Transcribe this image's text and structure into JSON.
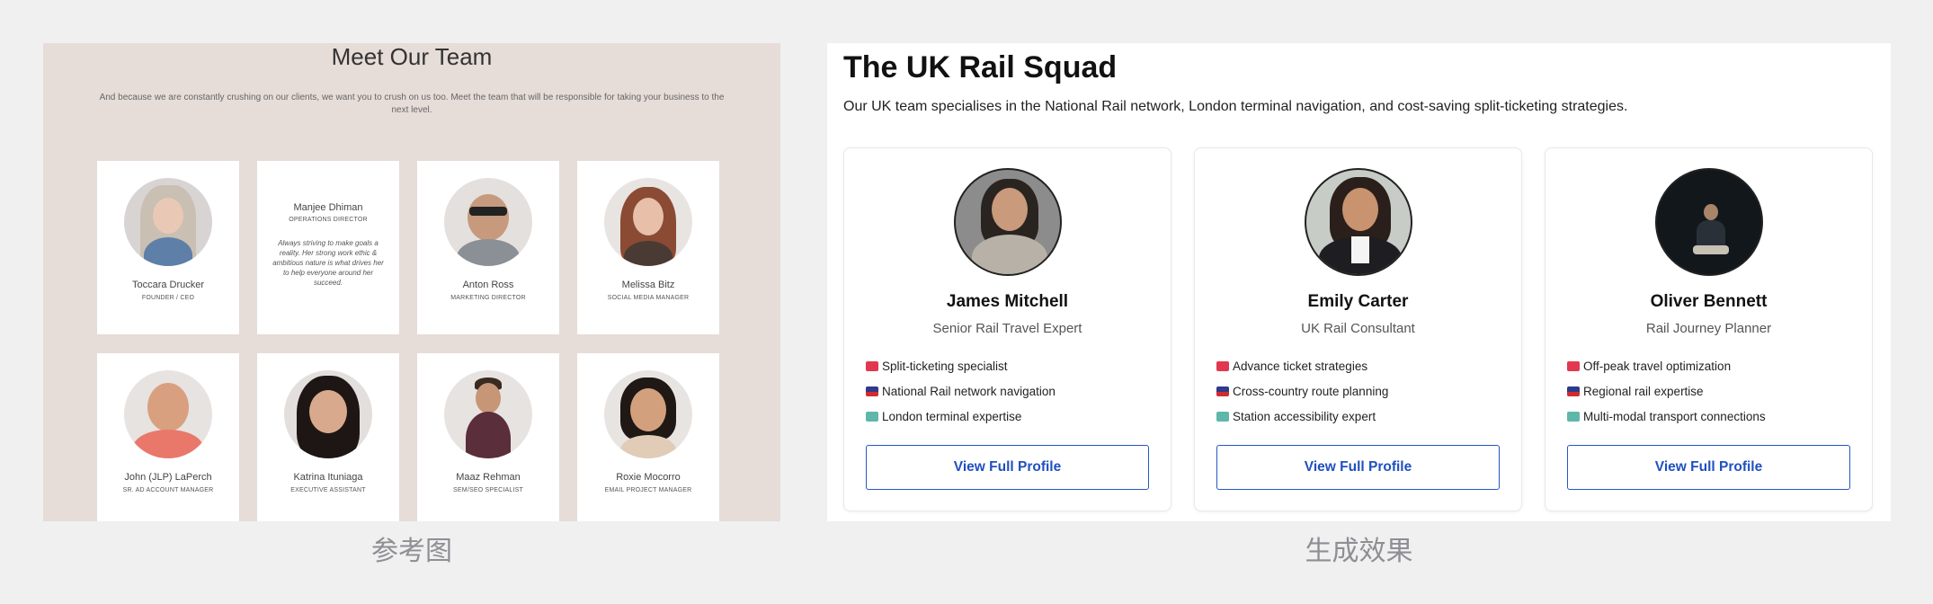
{
  "reference": {
    "caption": "参考图",
    "title": "Meet Our Team",
    "subtitle": "And because we are constantly crushing on our clients, we want you to crush on us too. Meet the team that will be responsible for taking your business to the next level.",
    "members": [
      {
        "name": "Toccara Drucker",
        "role": "FOUNDER / CEO"
      },
      {
        "name": "Manjee Dhiman",
        "role": "OPERATIONS DIRECTOR",
        "quote": "Always striving to make goals a reality. Her strong work ethic & ambitious nature is what drives her to help everyone around her succeed."
      },
      {
        "name": "Anton Ross",
        "role": "MARKETING DIRECTOR"
      },
      {
        "name": "Melissa Bitz",
        "role": "SOCIAL MEDIA MANAGER"
      },
      {
        "name": "John (JLP) LaPerch",
        "role": "SR. AD ACCOUNT MANAGER"
      },
      {
        "name": "Katrina Ituniaga",
        "role": "EXECUTIVE ASSISTANT"
      },
      {
        "name": "Maaz Rehman",
        "role": "SEM/SEO SPECIALIST"
      },
      {
        "name": "Roxie Mocorro",
        "role": "EMAIL PROJECT MANAGER"
      }
    ]
  },
  "generated": {
    "caption": "生成效果",
    "title": "The UK Rail Squad",
    "subtitle": "Our UK team specialises in the National Rail network, London terminal navigation, and cost-saving split-ticketing strategies.",
    "button_label": "View Full Profile",
    "colors": {
      "accent": "#2458c6",
      "title": "#111111"
    },
    "members": [
      {
        "name": "James Mitchell",
        "role": "Senior Rail Travel Expert",
        "skills": [
          {
            "icon": "ticket-icon",
            "text": "Split-ticketing specialist"
          },
          {
            "icon": "train-icon",
            "text": "National Rail network navigation"
          },
          {
            "icon": "map-icon",
            "text": "London terminal expertise"
          }
        ]
      },
      {
        "name": "Emily Carter",
        "role": "UK Rail Consultant",
        "skills": [
          {
            "icon": "ticket-icon",
            "text": "Advance ticket strategies"
          },
          {
            "icon": "train-icon",
            "text": "Cross-country route planning"
          },
          {
            "icon": "map-icon",
            "text": "Station accessibility expert"
          }
        ]
      },
      {
        "name": "Oliver Bennett",
        "role": "Rail Journey Planner",
        "skills": [
          {
            "icon": "ticket-icon",
            "text": "Off-peak travel optimization"
          },
          {
            "icon": "train-icon",
            "text": "Regional rail expertise"
          },
          {
            "icon": "map-icon",
            "text": "Multi-modal transport connections"
          }
        ]
      }
    ]
  }
}
